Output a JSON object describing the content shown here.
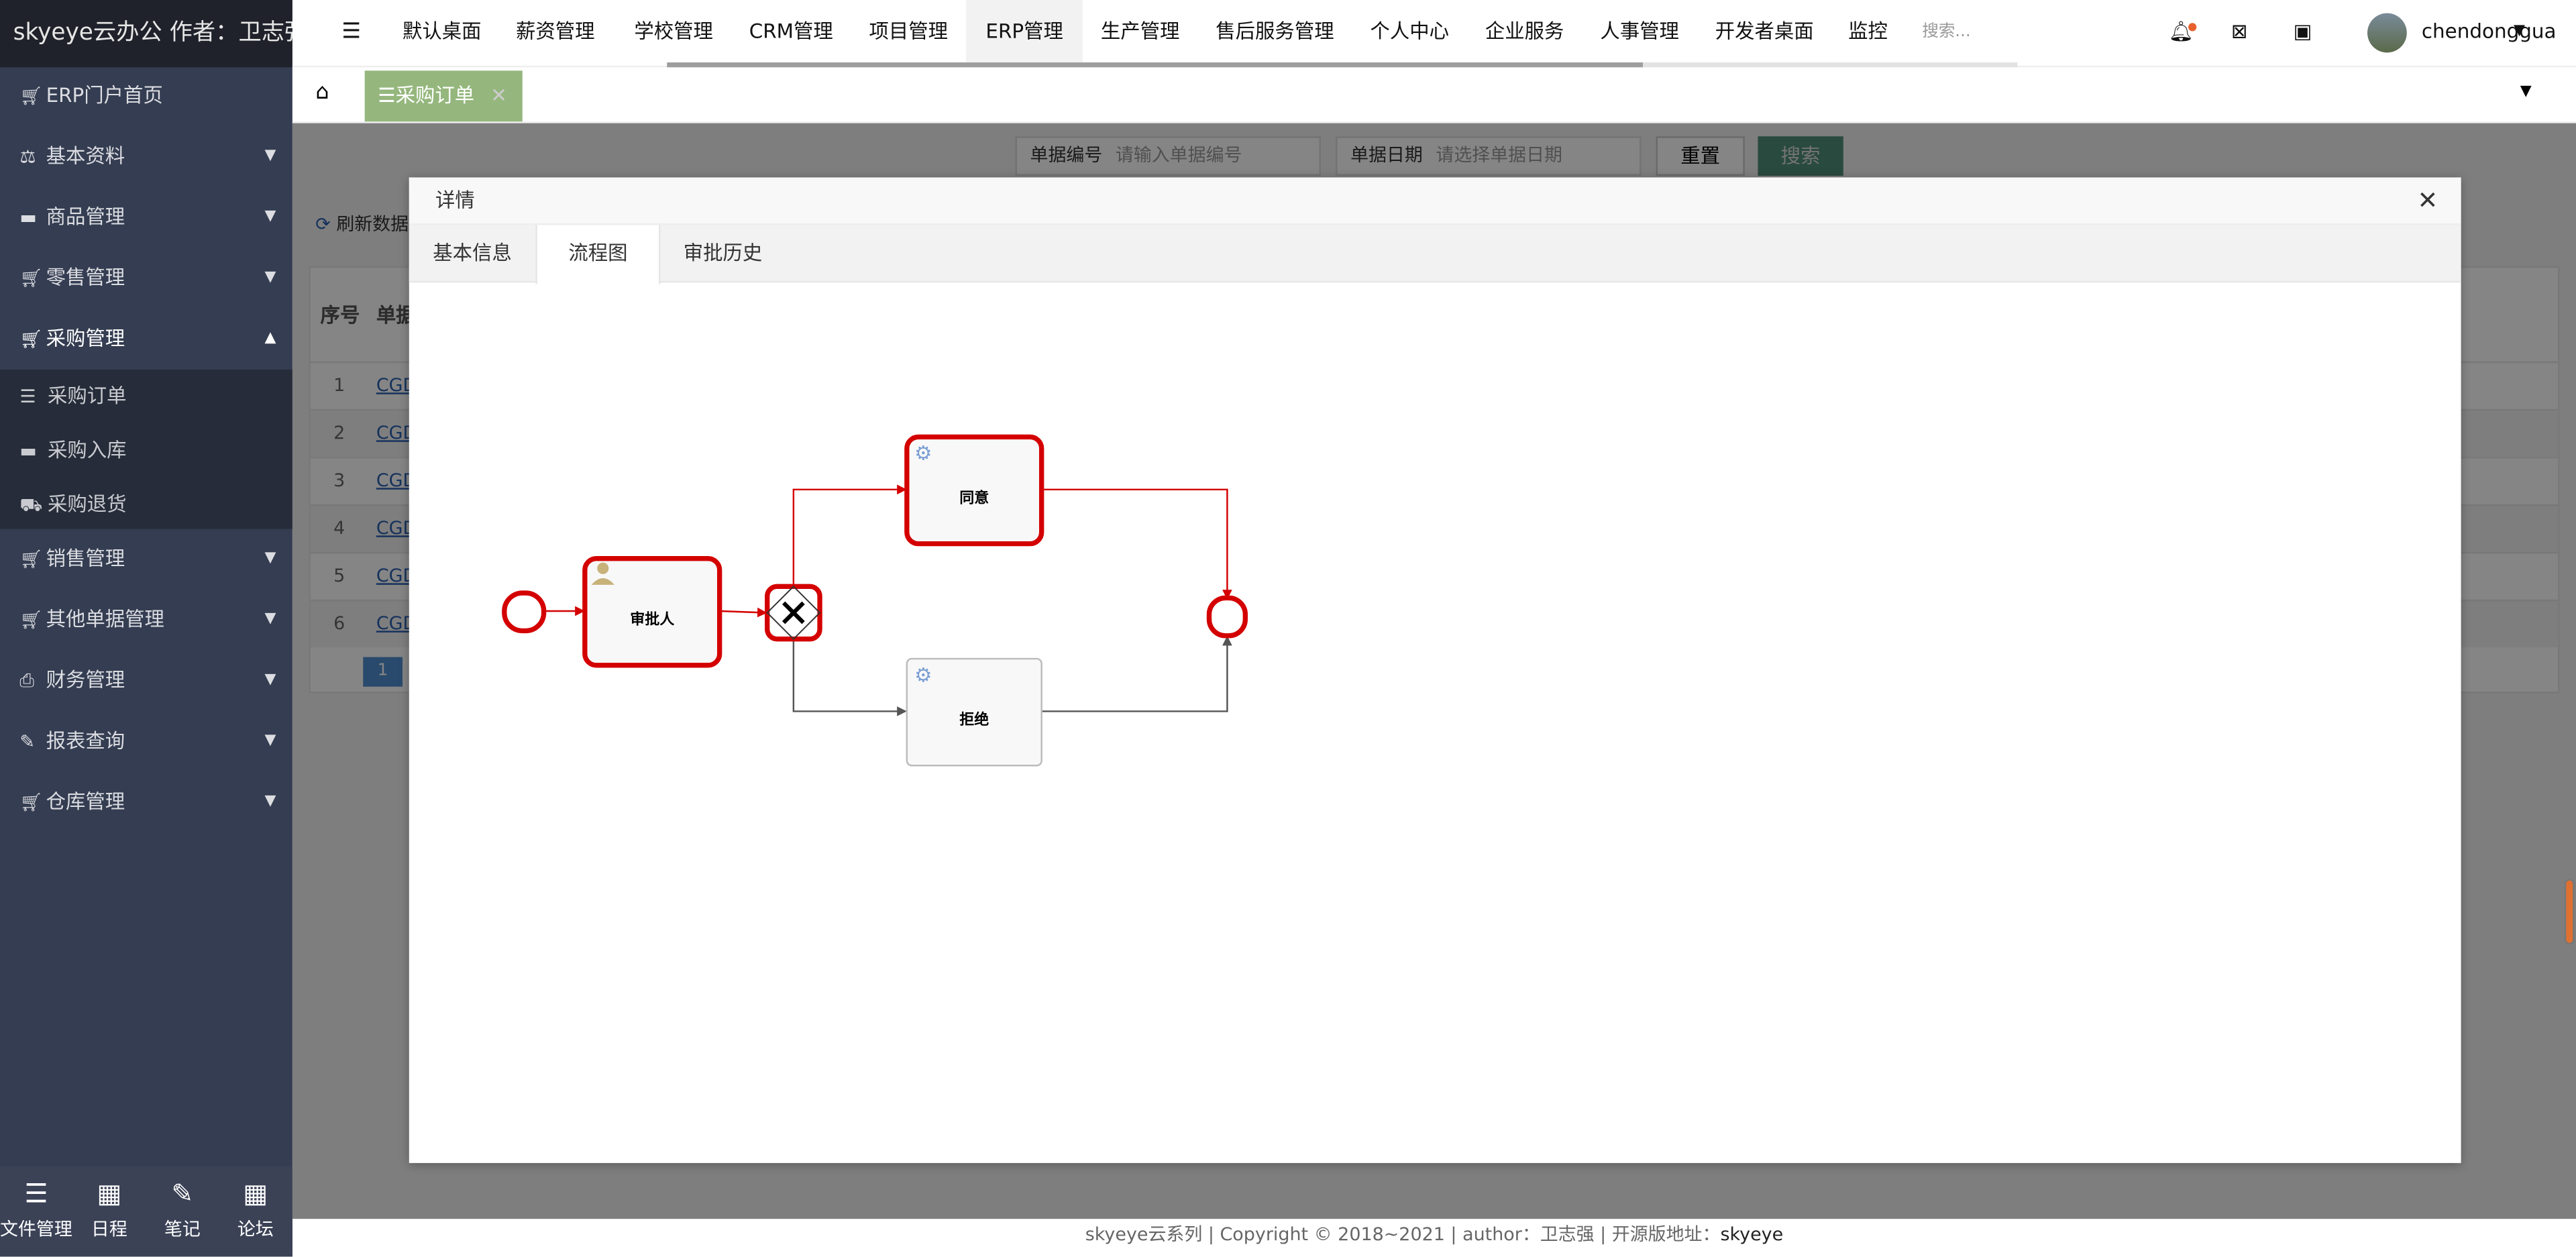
{
  "app": {
    "title": "skyeye云办公 作者：卫志强"
  },
  "sidebar": {
    "items": [
      {
        "label": "ERP门户首页",
        "icon": "cart-icon",
        "arrow": ""
      },
      {
        "label": "基本资料",
        "icon": "balance-scale-icon",
        "arrow": "▼"
      },
      {
        "label": "商品管理",
        "icon": "archive-icon",
        "arrow": "▼"
      },
      {
        "label": "零售管理",
        "icon": "cart-icon",
        "arrow": "▼"
      },
      {
        "label": "采购管理",
        "icon": "cart-icon",
        "arrow": "▲"
      },
      {
        "label": "销售管理",
        "icon": "cart-icon",
        "arrow": "▼"
      },
      {
        "label": "其他单据管理",
        "icon": "cart-icon",
        "arrow": "▼"
      },
      {
        "label": "财务管理",
        "icon": "print-icon",
        "arrow": "▼"
      },
      {
        "label": "报表查询",
        "icon": "edit-icon",
        "arrow": "▼"
      },
      {
        "label": "仓库管理",
        "icon": "cart-icon",
        "arrow": "▼"
      }
    ],
    "submenu": [
      {
        "label": "采购订单",
        "icon": "sliders-icon"
      },
      {
        "label": "采购入库",
        "icon": "archive-icon"
      },
      {
        "label": "采购退货",
        "icon": "truck-icon"
      }
    ],
    "tools": [
      {
        "label": "文件管理",
        "icon": "list-icon"
      },
      {
        "label": "日程",
        "icon": "calendar-icon"
      },
      {
        "label": "笔记",
        "icon": "edit-icon"
      },
      {
        "label": "论坛",
        "icon": "calendar-icon"
      }
    ]
  },
  "topnav": {
    "items": [
      "默认桌面",
      "薪资管理",
      "学校管理",
      "CRM管理",
      "项目管理",
      "ERP管理",
      "生产管理",
      "售后服务管理",
      "个人中心",
      "企业服务",
      "人事管理",
      "开发者桌面",
      "监控"
    ],
    "active": "ERP管理",
    "search_placeholder": "搜索...",
    "username": "chendonggua",
    "notify_color": "#e8612c"
  },
  "tabbar": {
    "tab": "采购订单"
  },
  "background": {
    "search": {
      "code_label": "单据编号",
      "code_placeholder": "请输入单据编号",
      "date_label": "单据日期",
      "date_placeholder": "请选择单据日期",
      "reset": "重置",
      "search": "搜索"
    },
    "refresh": "刷新数据",
    "table": {
      "headers": [
        "序号",
        "单据"
      ],
      "rows": [
        [
          "1",
          "CGD"
        ],
        [
          "2",
          "CGD"
        ],
        [
          "3",
          "CGD"
        ],
        [
          "4",
          "CGD"
        ],
        [
          "5",
          "CGD"
        ],
        [
          "6",
          "CGD"
        ]
      ]
    },
    "page": "1"
  },
  "modal": {
    "title": "详情",
    "tabs": [
      "基本信息",
      "流程图",
      "审批历史"
    ],
    "active_tab": "流程图"
  },
  "diagram": {
    "highlight_color": "#d40000",
    "nodes": {
      "approver": "审批人",
      "agree": "同意",
      "reject": "拒绝"
    }
  },
  "footer": {
    "text": "skyeye云系列 | Copyright © 2018~2021 | author：卫志强 | 开源版地址：",
    "link": "skyeye"
  }
}
